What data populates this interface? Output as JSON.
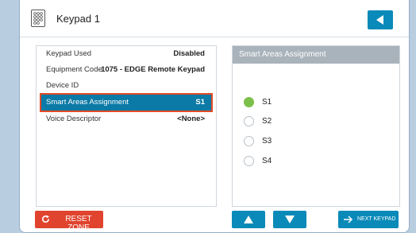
{
  "header": {
    "title": "Keypad 1"
  },
  "details": {
    "rows": [
      {
        "label": "Keypad Used",
        "value": "Disabled"
      },
      {
        "label": "Equipment Code",
        "value": "1075 - EDGE Remote Keypad"
      },
      {
        "label": "Device ID",
        "value": ""
      },
      {
        "label": "Smart Areas Assignment",
        "value": "S1"
      },
      {
        "label": "Voice Descriptor",
        "value": "<None>"
      }
    ],
    "selected_index": 3
  },
  "smart_areas": {
    "title": "Smart Areas Assignment",
    "options": [
      {
        "label": "S1",
        "selected": true
      },
      {
        "label": "S2",
        "selected": false
      },
      {
        "label": "S3",
        "selected": false
      },
      {
        "label": "S4",
        "selected": false
      }
    ]
  },
  "footer": {
    "reset_label": "RESET ZONE",
    "next_label": "NEXT KEYPAD"
  },
  "colors": {
    "accent": "#0a8ab8",
    "danger": "#e0442e",
    "selected_radio": "#7cc04b"
  }
}
